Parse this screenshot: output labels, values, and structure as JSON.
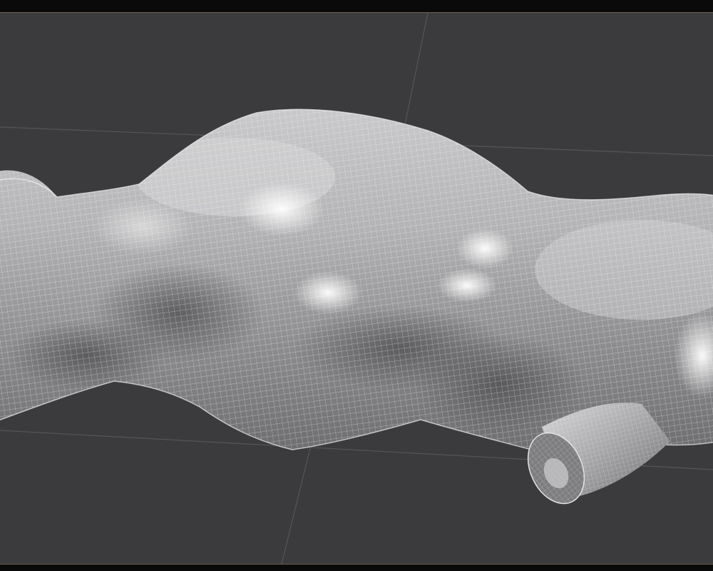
{
  "viewport": {
    "background_color": "#3b3b3d",
    "frame_border_color": "#6b604e",
    "grid_line_color": "#555558",
    "mesh": {
      "surface_color": "#8e8e90",
      "highlight_color": "#f2f2f2",
      "wireframe_color": "#e8e8e8",
      "display_mode": "wireframe-on-shaded"
    }
  }
}
